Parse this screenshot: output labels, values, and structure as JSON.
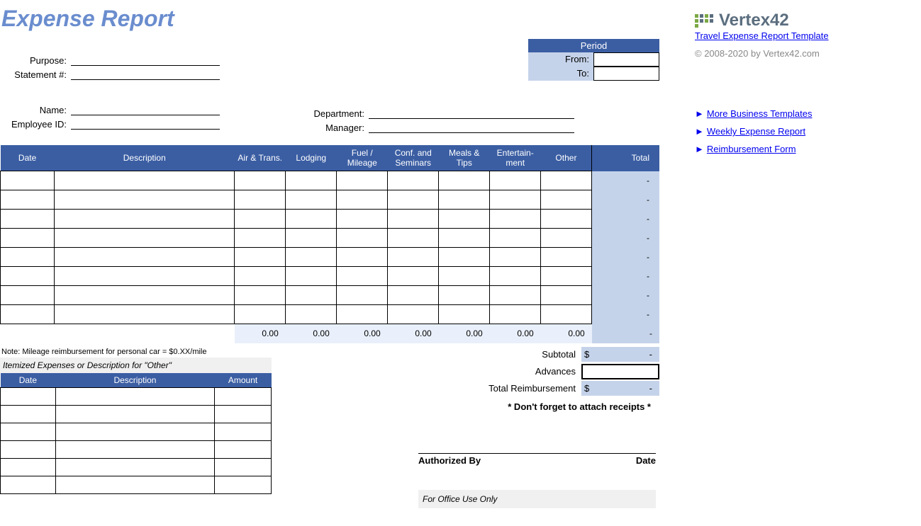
{
  "title": "Expense Report",
  "fields": {
    "purpose_label": "Purpose:",
    "statement_label": "Statement #:",
    "name_label": "Name:",
    "employee_id_label": "Employee ID:",
    "department_label": "Department:",
    "manager_label": "Manager:"
  },
  "period": {
    "header": "Period",
    "from_label": "From:",
    "to_label": "To:"
  },
  "table": {
    "headers": {
      "date": "Date",
      "description": "Description",
      "air_trans": "Air & Trans.",
      "lodging": "Lodging",
      "fuel_mileage": "Fuel / Mileage",
      "conf_seminars": "Conf. and Seminars",
      "meals_tips": "Meals & Tips",
      "entertainment": "Entertain-ment",
      "other": "Other",
      "total": "Total"
    },
    "row_total_placeholder": "-",
    "col_totals": [
      "0.00",
      "0.00",
      "0.00",
      "0.00",
      "0.00",
      "0.00",
      "0.00"
    ]
  },
  "note": "Note: Mileage reimbursement for personal car = $0.XX/mile",
  "itemized": {
    "title": "Itemized Expenses or Description for \"Other\"",
    "headers": {
      "date": "Date",
      "description": "Description",
      "amount": "Amount"
    }
  },
  "summary": {
    "subtotal_label": "Subtotal",
    "subtotal_value_prefix": "$",
    "subtotal_value": "-",
    "advances_label": "Advances",
    "total_reimb_label": "Total Reimbursement",
    "total_reimb_prefix": "$",
    "total_reimb_value": "-",
    "receipts_note": "* Don't forget to attach receipts *"
  },
  "signature": {
    "authorized_by": "Authorized By",
    "date": "Date",
    "office_use": "For Office Use Only"
  },
  "sidebar": {
    "logo_text": "Vertex42",
    "template_link": "Travel Expense Report Template",
    "copyright": "© 2008-2020 by Vertex42.com",
    "links": [
      "More Business Templates",
      "Weekly Expense Report",
      "Reimbursement Form"
    ]
  }
}
